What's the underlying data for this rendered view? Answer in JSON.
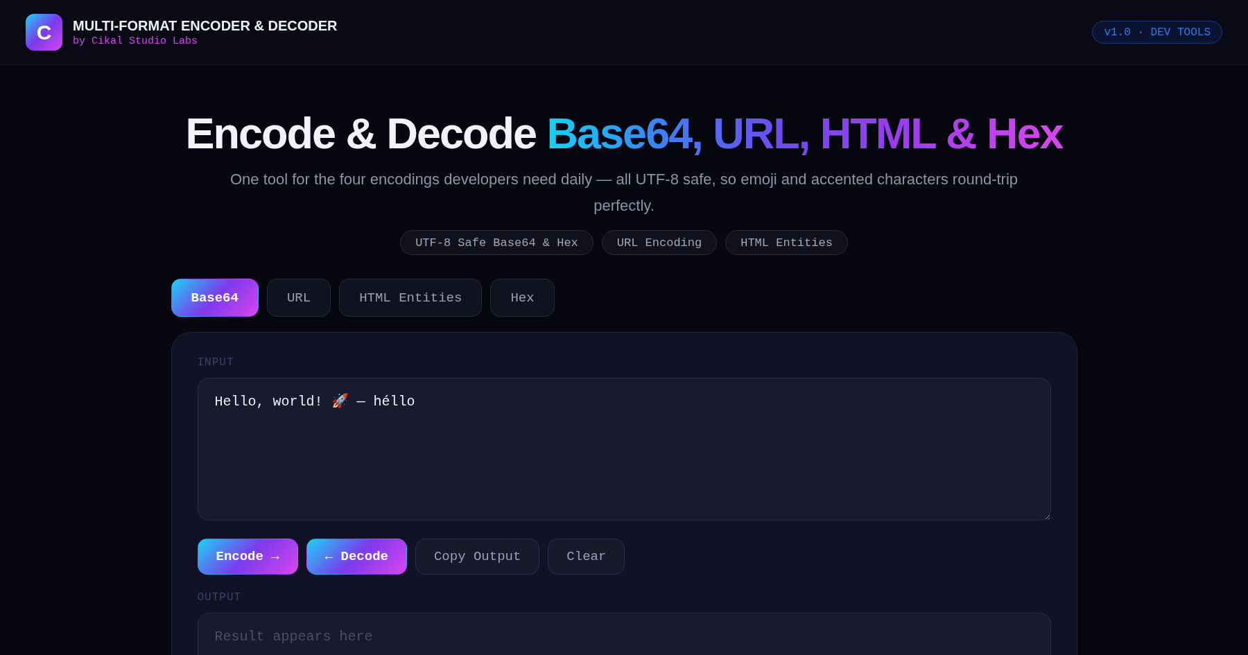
{
  "header": {
    "logo_text": "C",
    "title": "MULTI-FORMAT ENCODER & DECODER",
    "byline": "by Cikal Studio Labs",
    "badge": "v1.0 · DEV TOOLS"
  },
  "hero": {
    "title": "Encode & Decode",
    "title_highlight": "Base64, URL, HTML & Hex",
    "description": "One tool for the four encodings developers need daily — all UTF-8 safe, so emoji and accented characters round-trip perfectly.",
    "chips": [
      "UTF-8 Safe Base64 & Hex",
      "URL Encoding",
      "HTML Entities"
    ]
  },
  "tabs": [
    {
      "label": "Base64",
      "selected": true
    },
    {
      "label": "URL",
      "selected": false
    },
    {
      "label": "HTML Entities",
      "selected": false
    },
    {
      "label": "Hex",
      "selected": false
    }
  ],
  "input": {
    "label": "INPUT",
    "value": "Hello, world! 🚀 — héllo"
  },
  "actions": [
    {
      "label": "Encode →",
      "kind": "primary"
    },
    {
      "label": "← Decode",
      "kind": "primary"
    },
    {
      "label": "Copy Output",
      "kind": "secondary"
    },
    {
      "label": "Clear",
      "kind": "secondary"
    }
  ],
  "output": {
    "label": "OUTPUT",
    "placeholder": "Result appears here"
  }
}
